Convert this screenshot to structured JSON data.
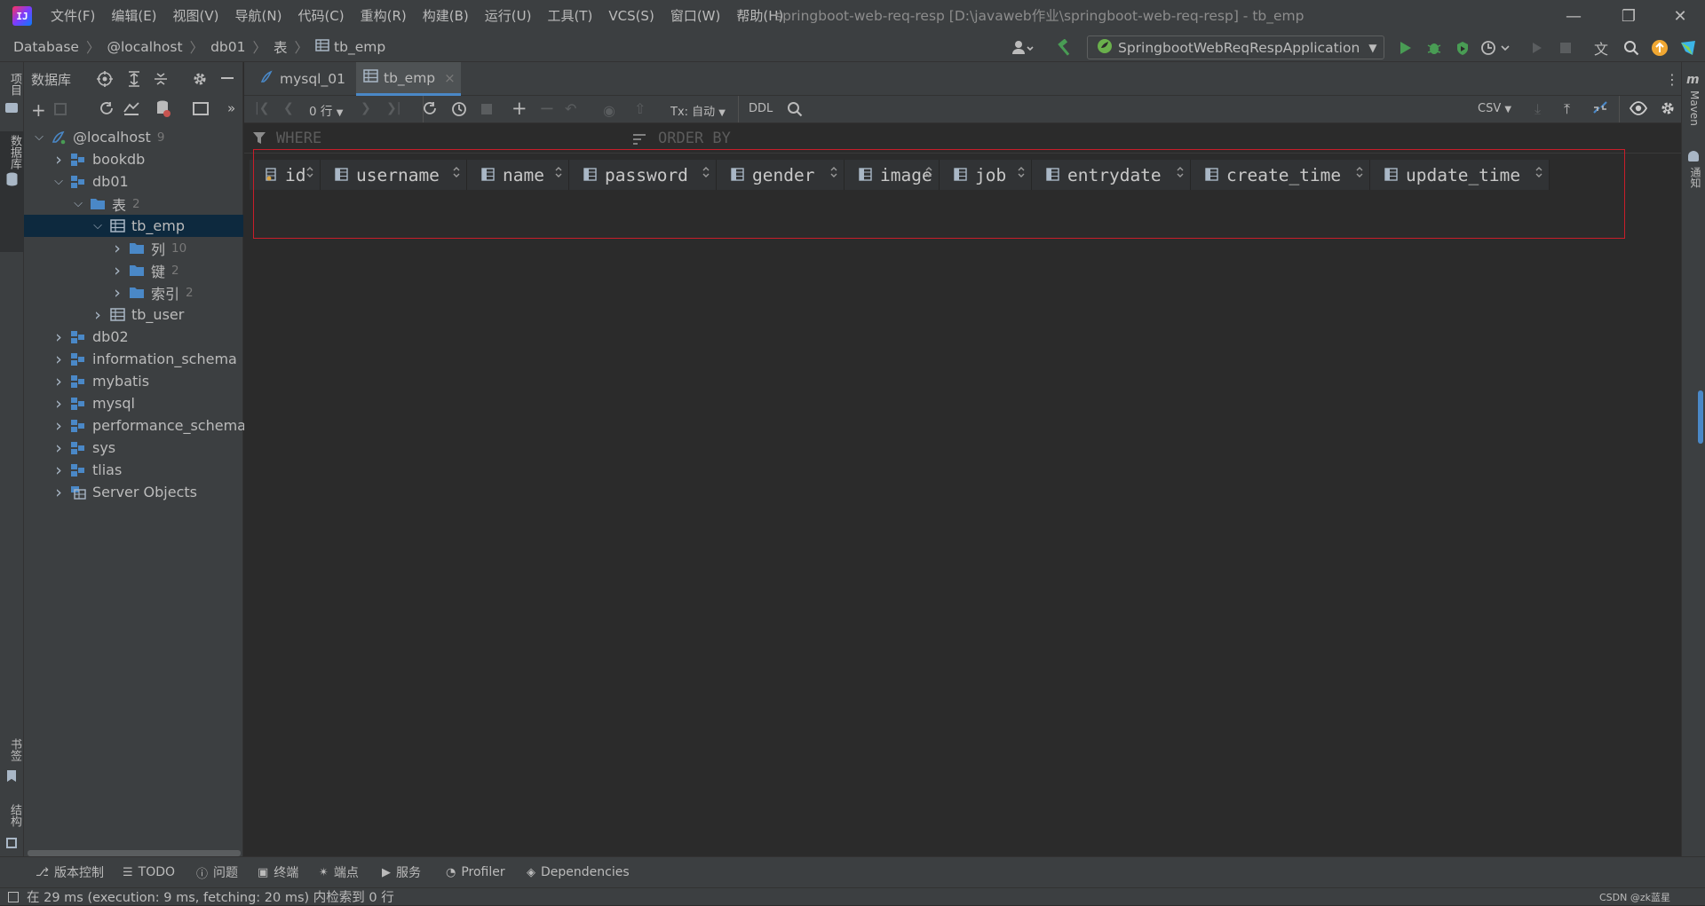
{
  "window": {
    "title": "springboot-web-req-resp [D:\\javaweb作业\\springboot-web-req-resp] - tb_emp",
    "logo_text": "IJ"
  },
  "menu": [
    "文件(F)",
    "编辑(E)",
    "视图(V)",
    "导航(N)",
    "代码(C)",
    "重构(R)",
    "构建(B)",
    "运行(U)",
    "工具(T)",
    "VCS(S)",
    "窗口(W)",
    "帮助(H)"
  ],
  "breadcrumb": [
    "Database",
    "@localhost",
    "db01",
    "表",
    "tb_emp"
  ],
  "run_config": "SpringbootWebReqRespApplication",
  "left_strip": {
    "project": "项目",
    "database": "数据库",
    "bookmarks": "书签",
    "structure": "结构"
  },
  "right_strip": {
    "maven": "Maven",
    "notifications": "通知"
  },
  "db_panel": {
    "title": "数据库",
    "tree": [
      {
        "label": "@localhost",
        "count": "9",
        "level": 0,
        "expanded": true,
        "icon": "server-icon"
      },
      {
        "label": "bookdb",
        "count": "",
        "level": 1,
        "expanded": false,
        "icon": "schema-icon"
      },
      {
        "label": "db01",
        "count": "",
        "level": 1,
        "expanded": true,
        "icon": "schema-icon"
      },
      {
        "label": "表",
        "count": "2",
        "level": 2,
        "expanded": true,
        "icon": "folder-icon"
      },
      {
        "label": "tb_emp",
        "count": "",
        "level": 3,
        "expanded": true,
        "icon": "table-icon",
        "selected": true
      },
      {
        "label": "列",
        "count": "10",
        "level": 4,
        "expanded": false,
        "icon": "folder-icon"
      },
      {
        "label": "键",
        "count": "2",
        "level": 4,
        "expanded": false,
        "icon": "folder-icon"
      },
      {
        "label": "索引",
        "count": "2",
        "level": 4,
        "expanded": false,
        "icon": "folder-icon"
      },
      {
        "label": "tb_user",
        "count": "",
        "level": 3,
        "expanded": false,
        "icon": "table-icon"
      },
      {
        "label": "db02",
        "count": "",
        "level": 1,
        "expanded": false,
        "icon": "schema-icon"
      },
      {
        "label": "information_schema",
        "count": "",
        "level": 1,
        "expanded": false,
        "icon": "schema-icon"
      },
      {
        "label": "mybatis",
        "count": "",
        "level": 1,
        "expanded": false,
        "icon": "schema-icon"
      },
      {
        "label": "mysql",
        "count": "",
        "level": 1,
        "expanded": false,
        "icon": "schema-icon"
      },
      {
        "label": "performance_schema",
        "count": "",
        "level": 1,
        "expanded": false,
        "icon": "schema-icon"
      },
      {
        "label": "sys",
        "count": "",
        "level": 1,
        "expanded": false,
        "icon": "schema-icon"
      },
      {
        "label": "tlias",
        "count": "",
        "level": 1,
        "expanded": false,
        "icon": "schema-icon"
      },
      {
        "label": "Server Objects",
        "count": "",
        "level": 1,
        "expanded": false,
        "icon": "server-objects-icon"
      }
    ]
  },
  "tabs": [
    {
      "label": "mysql_01",
      "active": false
    },
    {
      "label": "tb_emp",
      "active": true
    }
  ],
  "data_toolbar": {
    "rows": "0 行",
    "tx": "Tx: 自动",
    "ddl": "DDL",
    "export_format": "CSV"
  },
  "filter": {
    "where": "WHERE",
    "order_by": "ORDER BY"
  },
  "columns": [
    {
      "name": "id",
      "key": true
    },
    {
      "name": "username",
      "key": false
    },
    {
      "name": "name",
      "key": false
    },
    {
      "name": "password",
      "key": false
    },
    {
      "name": "gender",
      "key": false
    },
    {
      "name": "image",
      "key": false
    },
    {
      "name": "job",
      "key": false
    },
    {
      "name": "entrydate",
      "key": false
    },
    {
      "name": "create_time",
      "key": false
    },
    {
      "name": "update_time",
      "key": false
    }
  ],
  "bottom_tabs": [
    "版本控制",
    "TODO",
    "问题",
    "终端",
    "端点",
    "服务",
    "Profiler",
    "Dependencies"
  ],
  "status": {
    "message": "在 29 ms (execution: 9 ms, fetching: 20 ms) 内检索到 0 行",
    "watermark": "CSDN @zk蓝星"
  },
  "colors": {
    "bg": "#2b2b2b",
    "panel": "#3c3f41",
    "selection": "#0d293e",
    "accent": "#4a88c7",
    "highlight_box": "#c81e2a"
  }
}
